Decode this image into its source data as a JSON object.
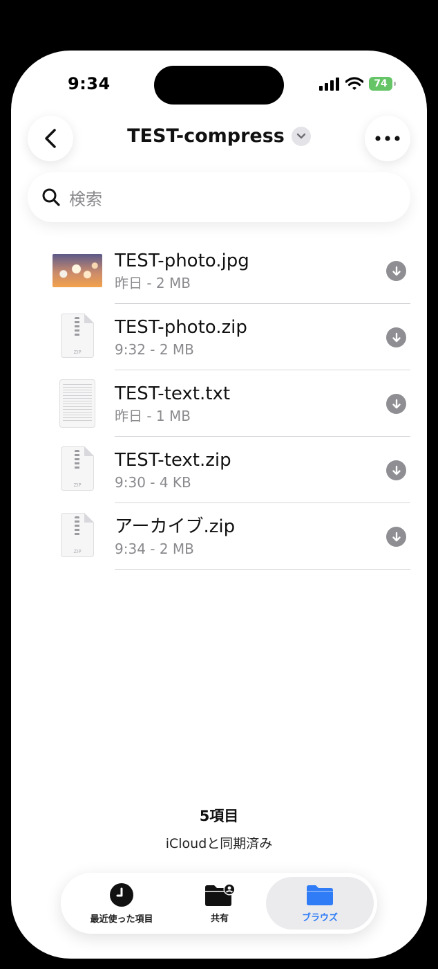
{
  "status_bar": {
    "time": "9:34",
    "battery": "74"
  },
  "nav": {
    "title": "TEST-compress",
    "back_icon": "chevron-left-icon",
    "more_icon": "ellipsis-icon"
  },
  "search": {
    "placeholder": "検索"
  },
  "files": [
    {
      "name": "TEST-photo.jpg",
      "meta": "昨日 - 2 MB",
      "kind": "photo"
    },
    {
      "name": "TEST-photo.zip",
      "meta": "9:32 - 2 MB",
      "kind": "zip"
    },
    {
      "name": "TEST-text.txt",
      "meta": "昨日 - 1 MB",
      "kind": "text"
    },
    {
      "name": "TEST-text.zip",
      "meta": "9:30 - 4 KB",
      "kind": "zip"
    },
    {
      "name": "アーカイブ.zip",
      "meta": "9:34 - 2 MB",
      "kind": "zip"
    }
  ],
  "zip_thumb_label": "ZIP",
  "footer": {
    "count": "5項目",
    "sync": "iCloudと同期済み"
  },
  "tabs": [
    {
      "label": "最近使った項目",
      "icon": "clock-icon"
    },
    {
      "label": "共有",
      "icon": "shared-folder-icon"
    },
    {
      "label": "ブラウズ",
      "icon": "folder-icon",
      "active": true
    }
  ],
  "colors": {
    "accent": "#2f7cf6",
    "battery": "#65c466",
    "secondary_text": "#8a8a8e"
  }
}
